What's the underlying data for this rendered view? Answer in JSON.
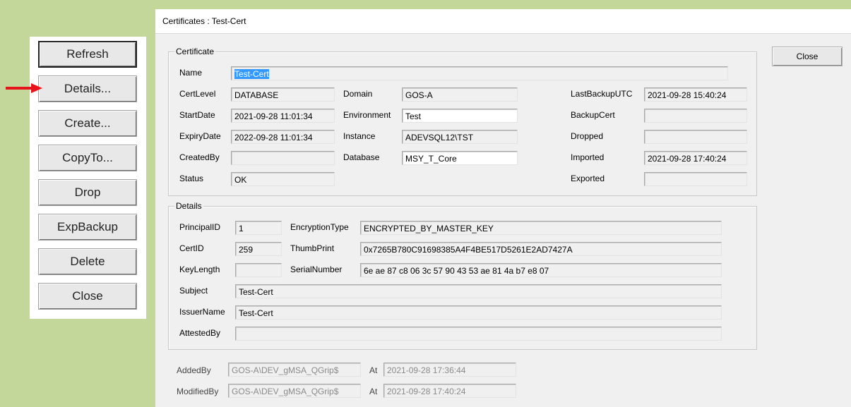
{
  "left_buttons": [
    "Refresh",
    "Details...",
    "Create...",
    "CopyTo...",
    "Drop",
    "ExpBackup",
    "Delete",
    "Close"
  ],
  "window": {
    "title": "Certificates : Test-Cert",
    "close_label": "Close"
  },
  "certificate": {
    "legend": "Certificate",
    "name_label": "Name",
    "name_value": "Test-Cert",
    "certlevel_label": "CertLevel",
    "certlevel_value": "DATABASE",
    "startdate_label": "StartDate",
    "startdate_value": "2021-09-28 11:01:34",
    "expirydate_label": "ExpiryDate",
    "expirydate_value": "2022-09-28 11:01:34",
    "createdby_label": "CreatedBy",
    "createdby_value": "",
    "status_label": "Status",
    "status_value": "OK",
    "domain_label": "Domain",
    "domain_value": "GOS-A",
    "environment_label": "Environment",
    "environment_value": "Test",
    "instance_label": "Instance",
    "instance_value": "ADEVSQL12\\TST",
    "database_label": "Database",
    "database_value": "MSY_T_Core",
    "lastbackup_label": "LastBackupUTC",
    "lastbackup_value": "2021-09-28 15:40:24",
    "backupcert_label": "BackupCert",
    "backupcert_value": "",
    "dropped_label": "Dropped",
    "dropped_value": "",
    "imported_label": "Imported",
    "imported_value": "2021-09-28 17:40:24",
    "exported_label": "Exported",
    "exported_value": ""
  },
  "details": {
    "legend": "Details",
    "principalid_label": "PrincipalID",
    "principalid_value": "1",
    "certid_label": "CertID",
    "certid_value": "259",
    "keylength_label": "KeyLength",
    "keylength_value": "",
    "encryption_label": "EncryptionType",
    "encryption_value": "ENCRYPTED_BY_MASTER_KEY",
    "thumbprint_label": "ThumbPrint",
    "thumbprint_value": "0x7265B780C91698385A4F4BE517D5261E2AD7427A",
    "serial_label": "SerialNumber",
    "serial_value": "6e ae 87 c8 06 3c 57 90 43 53 ae 81 4a b7 e8 07",
    "subject_label": "Subject",
    "subject_value": "Test-Cert",
    "issuer_label": "IssuerName",
    "issuer_value": "Test-Cert",
    "attested_label": "AttestedBy",
    "attested_value": ""
  },
  "audit": {
    "addedby_label": "AddedBy",
    "addedby_value": "GOS-A\\DEV_gMSA_QGrip$",
    "added_at_label": "At",
    "added_at_value": "2021-09-28 17:36:44",
    "modifiedby_label": "ModifiedBy",
    "modifiedby_value": "GOS-A\\DEV_gMSA_QGrip$",
    "modified_at_label": "At",
    "modified_at_value": "2021-09-28 17:40:24"
  },
  "colors": {
    "background": "#c4d79b",
    "arrow": "#e8141b",
    "selection": "#3399ff"
  }
}
